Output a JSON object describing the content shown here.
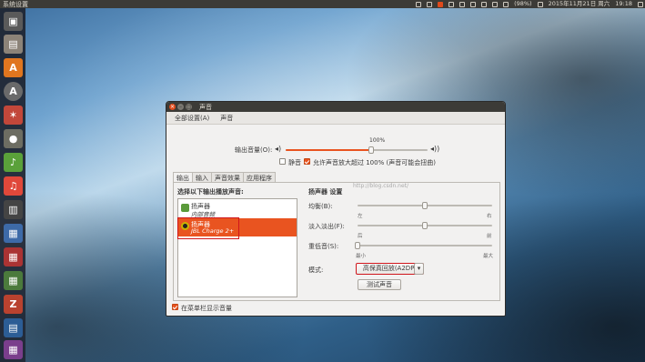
{
  "topbar": {
    "app_title": "系统设置",
    "battery": "(98%)",
    "datetime": "2015年11月21日 周六",
    "time": "19:18"
  },
  "launcher": {
    "items": [
      "files-icon",
      "software-center-icon",
      "updates-icon",
      "settings-icon",
      "disk-icon",
      "rhythmbox-icon",
      "music-icon",
      "printer-icon",
      "app-icon",
      "app-icon-2",
      "app-icon-3",
      "app-icon-4",
      "app-icon-5",
      "app-icon-6",
      "app-icon-7",
      "trash-icon"
    ]
  },
  "window": {
    "title": "声音",
    "toolbar": {
      "all_settings": "全部设置(A)",
      "current": "声音"
    },
    "output_volume_label": "输出音量(O):",
    "volume_percent_label": "100%",
    "volume_value": 0.6,
    "mute_label": "静音",
    "mute_checked": false,
    "overamp_label": "允许声音放大超过 100% (声音可能会扭曲)",
    "overamp_checked": true,
    "tabs": [
      "输出",
      "输入",
      "声音效果",
      "应用程序"
    ],
    "active_tab": "输出",
    "device_list_heading": "选择以下输出播放声音:",
    "devices": [
      {
        "name": "扬声器",
        "sub": "内部音频",
        "selected": false
      },
      {
        "name": "扬声器",
        "sub": "JBL Charge 2+",
        "selected": true
      }
    ],
    "settings_heading": "扬声器 设置",
    "watermark": "http://blog.csdn.net/",
    "balance_label": "均衡(B):",
    "balance_left": "左",
    "balance_right": "右",
    "balance_value": 0.5,
    "fade_label": "淡入淡出(F):",
    "fade_front": "后",
    "fade_back": "前",
    "fade_value": 0.5,
    "subwoofer_label": "重低音(S):",
    "sub_min": "最小",
    "sub_max": "最大",
    "subwoofer_value": 0.0,
    "mode_label": "模式:",
    "mode_value": "高保真回放(A2DP)",
    "test_button": "测试声音",
    "show_in_menu_label": "在菜单栏显示音量",
    "show_in_menu_checked": true
  }
}
